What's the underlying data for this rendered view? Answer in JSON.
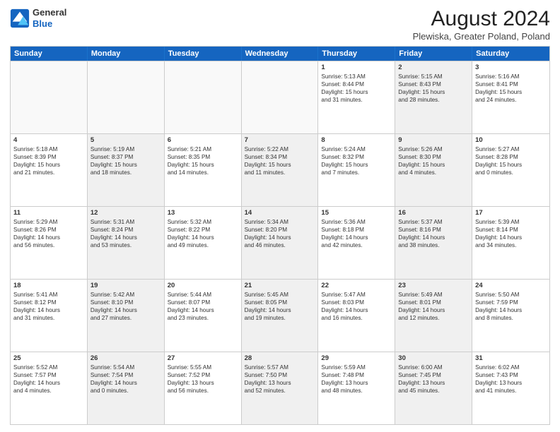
{
  "logo": {
    "line1": "General",
    "line2": "Blue"
  },
  "title": "August 2024",
  "subtitle": "Plewiska, Greater Poland, Poland",
  "header_days": [
    "Sunday",
    "Monday",
    "Tuesday",
    "Wednesday",
    "Thursday",
    "Friday",
    "Saturday"
  ],
  "weeks": [
    [
      {
        "day": "",
        "sunrise": "",
        "sunset": "",
        "daylight": "",
        "shaded": false,
        "empty": true
      },
      {
        "day": "",
        "sunrise": "",
        "sunset": "",
        "daylight": "",
        "shaded": false,
        "empty": true
      },
      {
        "day": "",
        "sunrise": "",
        "sunset": "",
        "daylight": "",
        "shaded": false,
        "empty": true
      },
      {
        "day": "",
        "sunrise": "",
        "sunset": "",
        "daylight": "",
        "shaded": false,
        "empty": true
      },
      {
        "day": "1",
        "sunrise": "Sunrise: 5:13 AM",
        "sunset": "Sunset: 8:44 PM",
        "daylight": "Daylight: 15 hours",
        "daylight2": "and 31 minutes.",
        "shaded": false,
        "empty": false
      },
      {
        "day": "2",
        "sunrise": "Sunrise: 5:15 AM",
        "sunset": "Sunset: 8:43 PM",
        "daylight": "Daylight: 15 hours",
        "daylight2": "and 28 minutes.",
        "shaded": true,
        "empty": false
      },
      {
        "day": "3",
        "sunrise": "Sunrise: 5:16 AM",
        "sunset": "Sunset: 8:41 PM",
        "daylight": "Daylight: 15 hours",
        "daylight2": "and 24 minutes.",
        "shaded": false,
        "empty": false
      }
    ],
    [
      {
        "day": "4",
        "sunrise": "Sunrise: 5:18 AM",
        "sunset": "Sunset: 8:39 PM",
        "daylight": "Daylight: 15 hours",
        "daylight2": "and 21 minutes.",
        "shaded": false,
        "empty": false
      },
      {
        "day": "5",
        "sunrise": "Sunrise: 5:19 AM",
        "sunset": "Sunset: 8:37 PM",
        "daylight": "Daylight: 15 hours",
        "daylight2": "and 18 minutes.",
        "shaded": true,
        "empty": false
      },
      {
        "day": "6",
        "sunrise": "Sunrise: 5:21 AM",
        "sunset": "Sunset: 8:35 PM",
        "daylight": "Daylight: 15 hours",
        "daylight2": "and 14 minutes.",
        "shaded": false,
        "empty": false
      },
      {
        "day": "7",
        "sunrise": "Sunrise: 5:22 AM",
        "sunset": "Sunset: 8:34 PM",
        "daylight": "Daylight: 15 hours",
        "daylight2": "and 11 minutes.",
        "shaded": true,
        "empty": false
      },
      {
        "day": "8",
        "sunrise": "Sunrise: 5:24 AM",
        "sunset": "Sunset: 8:32 PM",
        "daylight": "Daylight: 15 hours",
        "daylight2": "and 7 minutes.",
        "shaded": false,
        "empty": false
      },
      {
        "day": "9",
        "sunrise": "Sunrise: 5:26 AM",
        "sunset": "Sunset: 8:30 PM",
        "daylight": "Daylight: 15 hours",
        "daylight2": "and 4 minutes.",
        "shaded": true,
        "empty": false
      },
      {
        "day": "10",
        "sunrise": "Sunrise: 5:27 AM",
        "sunset": "Sunset: 8:28 PM",
        "daylight": "Daylight: 15 hours",
        "daylight2": "and 0 minutes.",
        "shaded": false,
        "empty": false
      }
    ],
    [
      {
        "day": "11",
        "sunrise": "Sunrise: 5:29 AM",
        "sunset": "Sunset: 8:26 PM",
        "daylight": "Daylight: 14 hours",
        "daylight2": "and 56 minutes.",
        "shaded": false,
        "empty": false
      },
      {
        "day": "12",
        "sunrise": "Sunrise: 5:31 AM",
        "sunset": "Sunset: 8:24 PM",
        "daylight": "Daylight: 14 hours",
        "daylight2": "and 53 minutes.",
        "shaded": true,
        "empty": false
      },
      {
        "day": "13",
        "sunrise": "Sunrise: 5:32 AM",
        "sunset": "Sunset: 8:22 PM",
        "daylight": "Daylight: 14 hours",
        "daylight2": "and 49 minutes.",
        "shaded": false,
        "empty": false
      },
      {
        "day": "14",
        "sunrise": "Sunrise: 5:34 AM",
        "sunset": "Sunset: 8:20 PM",
        "daylight": "Daylight: 14 hours",
        "daylight2": "and 46 minutes.",
        "shaded": true,
        "empty": false
      },
      {
        "day": "15",
        "sunrise": "Sunrise: 5:36 AM",
        "sunset": "Sunset: 8:18 PM",
        "daylight": "Daylight: 14 hours",
        "daylight2": "and 42 minutes.",
        "shaded": false,
        "empty": false
      },
      {
        "day": "16",
        "sunrise": "Sunrise: 5:37 AM",
        "sunset": "Sunset: 8:16 PM",
        "daylight": "Daylight: 14 hours",
        "daylight2": "and 38 minutes.",
        "shaded": true,
        "empty": false
      },
      {
        "day": "17",
        "sunrise": "Sunrise: 5:39 AM",
        "sunset": "Sunset: 8:14 PM",
        "daylight": "Daylight: 14 hours",
        "daylight2": "and 34 minutes.",
        "shaded": false,
        "empty": false
      }
    ],
    [
      {
        "day": "18",
        "sunrise": "Sunrise: 5:41 AM",
        "sunset": "Sunset: 8:12 PM",
        "daylight": "Daylight: 14 hours",
        "daylight2": "and 31 minutes.",
        "shaded": false,
        "empty": false
      },
      {
        "day": "19",
        "sunrise": "Sunrise: 5:42 AM",
        "sunset": "Sunset: 8:10 PM",
        "daylight": "Daylight: 14 hours",
        "daylight2": "and 27 minutes.",
        "shaded": true,
        "empty": false
      },
      {
        "day": "20",
        "sunrise": "Sunrise: 5:44 AM",
        "sunset": "Sunset: 8:07 PM",
        "daylight": "Daylight: 14 hours",
        "daylight2": "and 23 minutes.",
        "shaded": false,
        "empty": false
      },
      {
        "day": "21",
        "sunrise": "Sunrise: 5:45 AM",
        "sunset": "Sunset: 8:05 PM",
        "daylight": "Daylight: 14 hours",
        "daylight2": "and 19 minutes.",
        "shaded": true,
        "empty": false
      },
      {
        "day": "22",
        "sunrise": "Sunrise: 5:47 AM",
        "sunset": "Sunset: 8:03 PM",
        "daylight": "Daylight: 14 hours",
        "daylight2": "and 16 minutes.",
        "shaded": false,
        "empty": false
      },
      {
        "day": "23",
        "sunrise": "Sunrise: 5:49 AM",
        "sunset": "Sunset: 8:01 PM",
        "daylight": "Daylight: 14 hours",
        "daylight2": "and 12 minutes.",
        "shaded": true,
        "empty": false
      },
      {
        "day": "24",
        "sunrise": "Sunrise: 5:50 AM",
        "sunset": "Sunset: 7:59 PM",
        "daylight": "Daylight: 14 hours",
        "daylight2": "and 8 minutes.",
        "shaded": false,
        "empty": false
      }
    ],
    [
      {
        "day": "25",
        "sunrise": "Sunrise: 5:52 AM",
        "sunset": "Sunset: 7:57 PM",
        "daylight": "Daylight: 14 hours",
        "daylight2": "and 4 minutes.",
        "shaded": false,
        "empty": false
      },
      {
        "day": "26",
        "sunrise": "Sunrise: 5:54 AM",
        "sunset": "Sunset: 7:54 PM",
        "daylight": "Daylight: 14 hours",
        "daylight2": "and 0 minutes.",
        "shaded": true,
        "empty": false
      },
      {
        "day": "27",
        "sunrise": "Sunrise: 5:55 AM",
        "sunset": "Sunset: 7:52 PM",
        "daylight": "Daylight: 13 hours",
        "daylight2": "and 56 minutes.",
        "shaded": false,
        "empty": false
      },
      {
        "day": "28",
        "sunrise": "Sunrise: 5:57 AM",
        "sunset": "Sunset: 7:50 PM",
        "daylight": "Daylight: 13 hours",
        "daylight2": "and 52 minutes.",
        "shaded": true,
        "empty": false
      },
      {
        "day": "29",
        "sunrise": "Sunrise: 5:59 AM",
        "sunset": "Sunset: 7:48 PM",
        "daylight": "Daylight: 13 hours",
        "daylight2": "and 48 minutes.",
        "shaded": false,
        "empty": false
      },
      {
        "day": "30",
        "sunrise": "Sunrise: 6:00 AM",
        "sunset": "Sunset: 7:45 PM",
        "daylight": "Daylight: 13 hours",
        "daylight2": "and 45 minutes.",
        "shaded": true,
        "empty": false
      },
      {
        "day": "31",
        "sunrise": "Sunrise: 6:02 AM",
        "sunset": "Sunset: 7:43 PM",
        "daylight": "Daylight: 13 hours",
        "daylight2": "and 41 minutes.",
        "shaded": false,
        "empty": false
      }
    ]
  ]
}
